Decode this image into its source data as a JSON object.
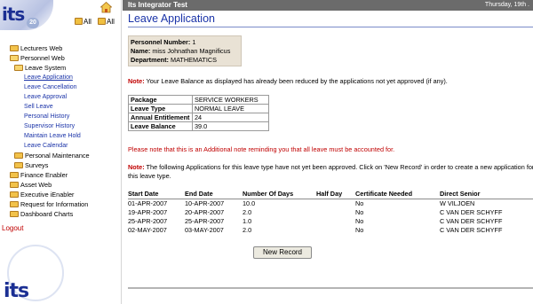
{
  "sidebar": {
    "logo_text": "its",
    "logo_badge": "20",
    "links": {
      "all_1": "All",
      "all_2": "All"
    },
    "nav": [
      {
        "label": "Lecturers Web",
        "kind": "folder"
      },
      {
        "label": "Personnel Web",
        "kind": "folder-open"
      },
      {
        "label": "Leave System",
        "kind": "folder-open"
      },
      {
        "label": "Leave Application",
        "kind": "link",
        "active": true
      },
      {
        "label": "Leave Cancellation",
        "kind": "link"
      },
      {
        "label": "Leave Approval",
        "kind": "link"
      },
      {
        "label": "Sell Leave",
        "kind": "link"
      },
      {
        "label": "Personal History",
        "kind": "link"
      },
      {
        "label": "Supervisor History",
        "kind": "link"
      },
      {
        "label": "Maintain Leave Hold",
        "kind": "link"
      },
      {
        "label": "Leave Calendar",
        "kind": "link"
      },
      {
        "label": "Personal Maintenance",
        "kind": "folder"
      },
      {
        "label": "Surveys",
        "kind": "folder"
      },
      {
        "label": "Finance Enabler",
        "kind": "folder"
      },
      {
        "label": "Asset Web",
        "kind": "folder"
      },
      {
        "label": "Executive iEnabler",
        "kind": "folder"
      },
      {
        "label": "Request for Information",
        "kind": "folder"
      },
      {
        "label": "Dashboard Charts",
        "kind": "folder"
      }
    ],
    "logout": "Logout",
    "bottom_logo_text": "its"
  },
  "titlebar": {
    "app_name": "Its Integrator Test",
    "date": "Thursday, 19th ."
  },
  "page_title": "Leave Application",
  "personnel": {
    "number_label": "Personnel Number:",
    "number": "1",
    "name_label": "Name:",
    "name": "miss Johnathan Magnificus",
    "dept_label": "Department:",
    "dept": "MATHEMATICS"
  },
  "note1": {
    "label": "Note:",
    "text": " Your Leave Balance as displayed has already been reduced by the applications not yet approved (if any)."
  },
  "package_table": [
    {
      "key": "Package",
      "value": "SERVICE WORKERS"
    },
    {
      "key": "Leave Type",
      "value": "NORMAL LEAVE"
    },
    {
      "key": "Annual Entitlement",
      "value": "24"
    },
    {
      "key": "Leave Balance",
      "value": "39.0"
    }
  ],
  "additional_note": "Please note that this is an Additional note reminding you that all leave must be accounted for.",
  "note2": {
    "label": "Note:",
    "text": " The following Applications for this leave type have not yet been approved. Click on 'New Record' in order to create a new application for this leave type."
  },
  "applications": {
    "headers": [
      "Start Date",
      "End Date",
      "Number Of Days",
      "Half Day",
      "Certificate Needed",
      "Direct Senior"
    ],
    "rows": [
      [
        "01-APR-2007",
        "10-APR-2007",
        "10.0",
        "",
        "No",
        "W VILJOEN"
      ],
      [
        "19-APR-2007",
        "20-APR-2007",
        "2.0",
        "",
        "No",
        "C VAN DER SCHYFF"
      ],
      [
        "25-APR-2007",
        "25-APR-2007",
        "1.0",
        "",
        "No",
        "C VAN DER SCHYFF"
      ],
      [
        "02-MAY-2007",
        "03-MAY-2007",
        "2.0",
        "",
        "No",
        "C VAN DER SCHYFF"
      ]
    ]
  },
  "new_record_label": "New Record"
}
